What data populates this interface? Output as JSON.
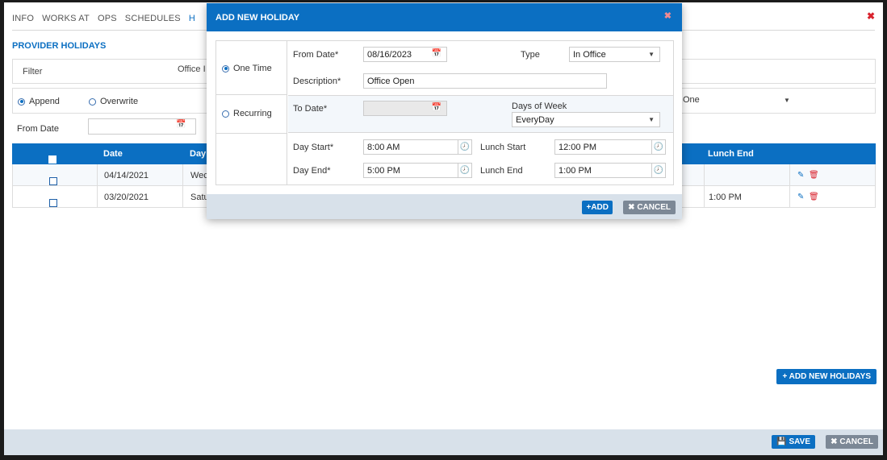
{
  "tabs": [
    "INFO",
    "WORKS AT",
    "OPS",
    "SCHEDULES",
    "H"
  ],
  "section_title": "PROVIDER HOLIDAYS",
  "filter": {
    "label": "Filter",
    "office_label": "Office I"
  },
  "options": {
    "append": "Append",
    "overwrite": "Overwrite",
    "one_value": "One"
  },
  "from_date_label": "From Date",
  "table": {
    "headers": [
      "Date",
      "Day",
      "Lunch End"
    ],
    "rows": [
      {
        "date": "04/14/2021",
        "day": "Wec",
        "lunch_end": ""
      },
      {
        "date": "03/20/2021",
        "day": "Satu",
        "lunch_end": "1:00 PM"
      }
    ]
  },
  "add_holidays_label": "+ ADD NEW HOLIDAYS",
  "footer": {
    "save": "SAVE",
    "cancel": "CANCEL"
  },
  "modal": {
    "title": "ADD NEW HOLIDAY",
    "one_time": "One Time",
    "recurring": "Recurring",
    "from_date_label": "From Date*",
    "from_date_value": "08/16/2023",
    "type_label": "Type",
    "type_value": "In Office",
    "description_label": "Description*",
    "description_value": "Office Open",
    "to_date_label": "To Date*",
    "days_of_week_label": "Days of Week",
    "days_of_week_value": "EveryDay",
    "day_start_label": "Day Start*",
    "day_start_value": "8:00 AM",
    "day_end_label": "Day End*",
    "day_end_value": "5:00 PM",
    "lunch_start_label": "Lunch Start",
    "lunch_start_value": "12:00 PM",
    "lunch_end_label": "Lunch End",
    "lunch_end_value": "1:00 PM",
    "add": "+ADD",
    "cancel": "CANCEL"
  },
  "colors": {
    "primary": "#0b6fc2",
    "danger": "#d9232e",
    "secondary": "#7c8896",
    "footer_bg": "#d8e1ea"
  }
}
